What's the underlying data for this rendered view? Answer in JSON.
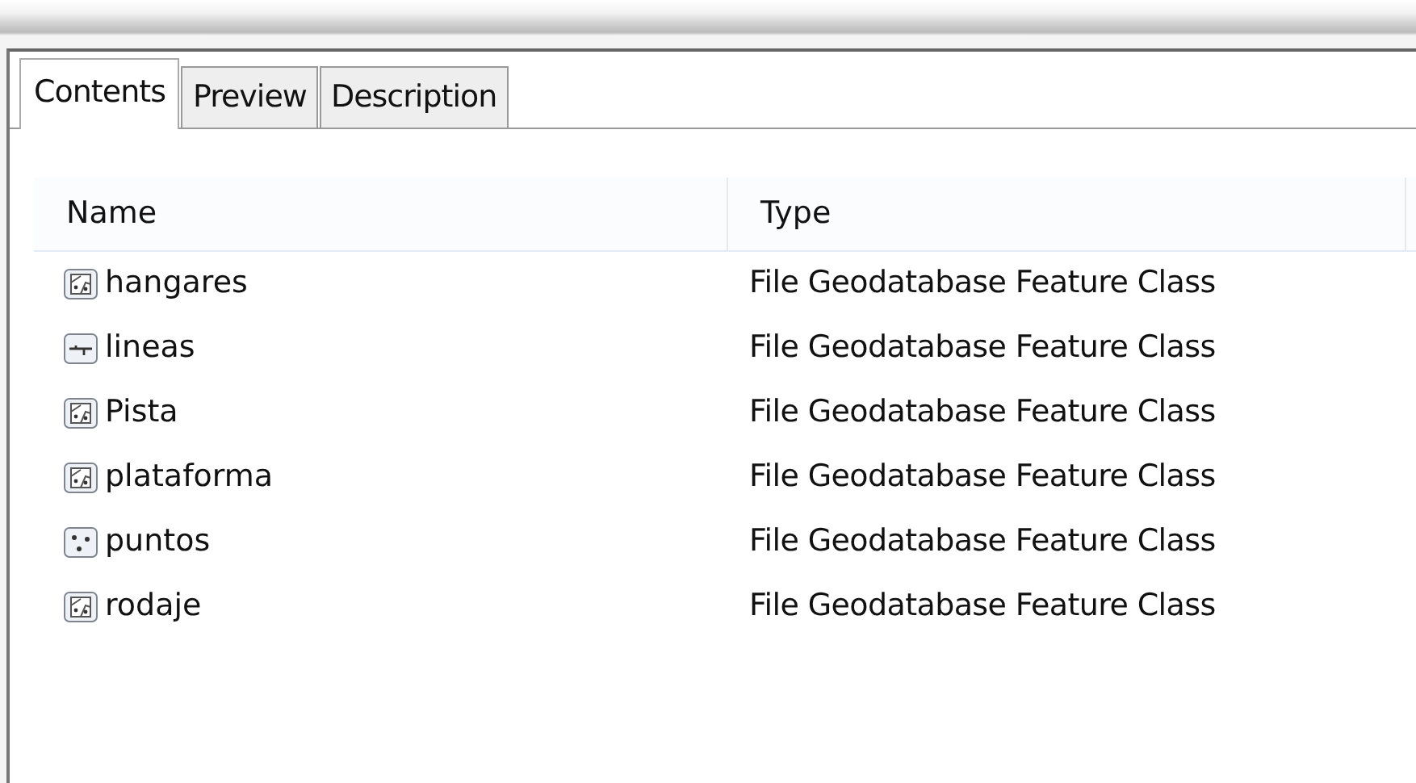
{
  "tabs": [
    {
      "label": "Contents",
      "selected": true
    },
    {
      "label": "Preview",
      "selected": false
    },
    {
      "label": "Description",
      "selected": false
    }
  ],
  "table": {
    "columns": [
      "Name",
      "Type"
    ],
    "rows": [
      {
        "name": "hangares",
        "kind": "polygon",
        "type": "File Geodatabase Feature Class"
      },
      {
        "name": "lineas",
        "kind": "line",
        "type": "File Geodatabase Feature Class"
      },
      {
        "name": "Pista",
        "kind": "polygon",
        "type": "File Geodatabase Feature Class"
      },
      {
        "name": "plataforma",
        "kind": "polygon",
        "type": "File Geodatabase Feature Class"
      },
      {
        "name": "puntos",
        "kind": "point",
        "type": "File Geodatabase Feature Class"
      },
      {
        "name": "rodaje",
        "kind": "polygon",
        "type": "File Geodatabase Feature Class"
      }
    ]
  }
}
